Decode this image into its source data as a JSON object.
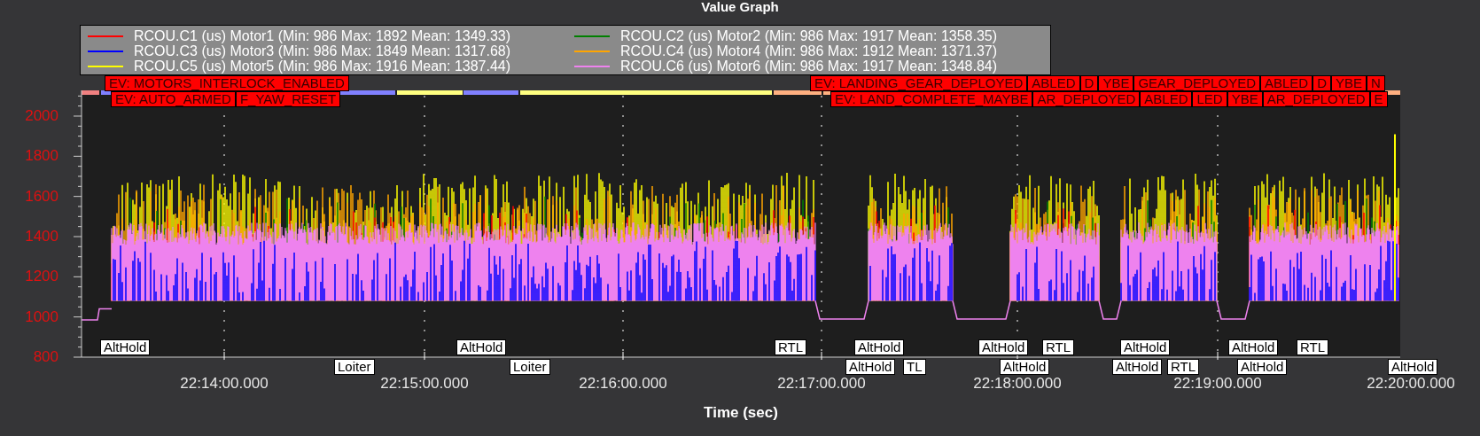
{
  "title": "Value Graph",
  "legend": [
    {
      "label": "RCOU.C1 (us) Motor1 (Min: 986 Max: 1892 Mean: 1349.33)",
      "color": "#ff0000"
    },
    {
      "label": "RCOU.C2 (us) Motor2 (Min: 986 Max: 1917 Mean: 1358.35)",
      "color": "#008000"
    },
    {
      "label": "RCOU.C3 (us) Motor3 (Min: 986 Max: 1849 Mean: 1317.68)",
      "color": "#0000ff"
    },
    {
      "label": "RCOU.C4 (us) Motor4 (Min: 986 Max: 1912 Mean: 1371.37)",
      "color": "#ffa500"
    },
    {
      "label": "RCOU.C5 (us) Motor5 (Min: 986 Max: 1916 Mean: 1387.44)",
      "color": "#ffff00"
    },
    {
      "label": "RCOU.C6 (us) Motor6 (Min: 986 Max: 1917 Mean: 1348.84)",
      "color": "#ee82ee"
    }
  ],
  "events_left_row_1": [
    "EV: MOTORS_INTERLOCK_ENABLED"
  ],
  "events_left_row_2": [
    "EV: AUTO_ARMED",
    "F_YAW_RESET"
  ],
  "events_right_row_1": [
    "EV: LANDING_GEAR_DEPLOYED",
    "ABLED",
    "D",
    "YBE",
    "GEAR_DEPLOYED",
    "ABLED",
    "D",
    "YBE",
    "N"
  ],
  "events_right_row_2": [
    "EV: LAND_COMPLETE_MAYBE",
    "AR_DEPLOYED",
    "ABLED",
    "LED",
    "YBE",
    "AR_DEPLOYED",
    "E"
  ],
  "y_ticks": [
    "2000",
    "1800",
    "1600",
    "1400",
    "1200",
    "1000",
    "800"
  ],
  "x_ticks": [
    "22:14:00.000",
    "22:15:00.000",
    "22:16:00.000",
    "22:17:00.000",
    "22:18:00.000",
    "22:19:00.000",
    "22:20:00.000"
  ],
  "x_label": "Time (sec)",
  "mode_labels_upper": [
    "AltHold",
    "AltHold",
    "RTL",
    "AltHold",
    "AltHold",
    "RTL",
    "AltHold",
    "AltHold",
    "RTL"
  ],
  "mode_labels_lower": [
    "Loiter",
    "Loiter",
    "AltHold",
    "TL",
    "AltHold",
    "AltHold",
    "RTL",
    "AltHold",
    "AltHold"
  ]
}
